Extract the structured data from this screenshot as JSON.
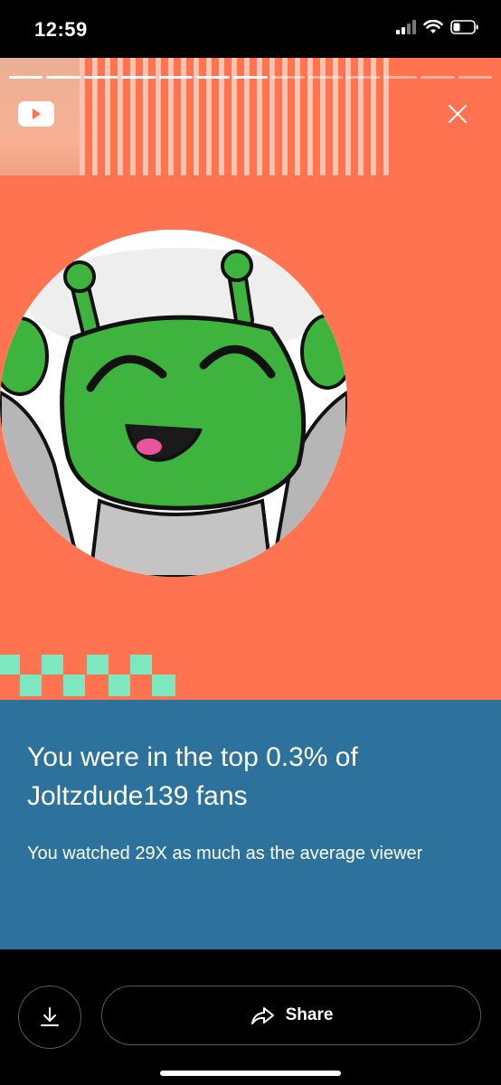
{
  "status_bar": {
    "time": "12:59"
  },
  "story": {
    "background_color": "#FF7350",
    "progress_segments_total": 13,
    "progress_segments_done": 7,
    "logo_icon": "youtube-icon",
    "close_icon": "close-icon",
    "avatar_icon": "green-alien-cartoon-avatar"
  },
  "stat": {
    "headline": "You were in the top 0.3% of Joltzdude139 fans",
    "subline": "You watched 29X as much as the average viewer",
    "panel_color": "#2C729C"
  },
  "actions": {
    "download_icon": "download-icon",
    "share_icon": "share-arrow-icon",
    "share_label": "Share"
  }
}
